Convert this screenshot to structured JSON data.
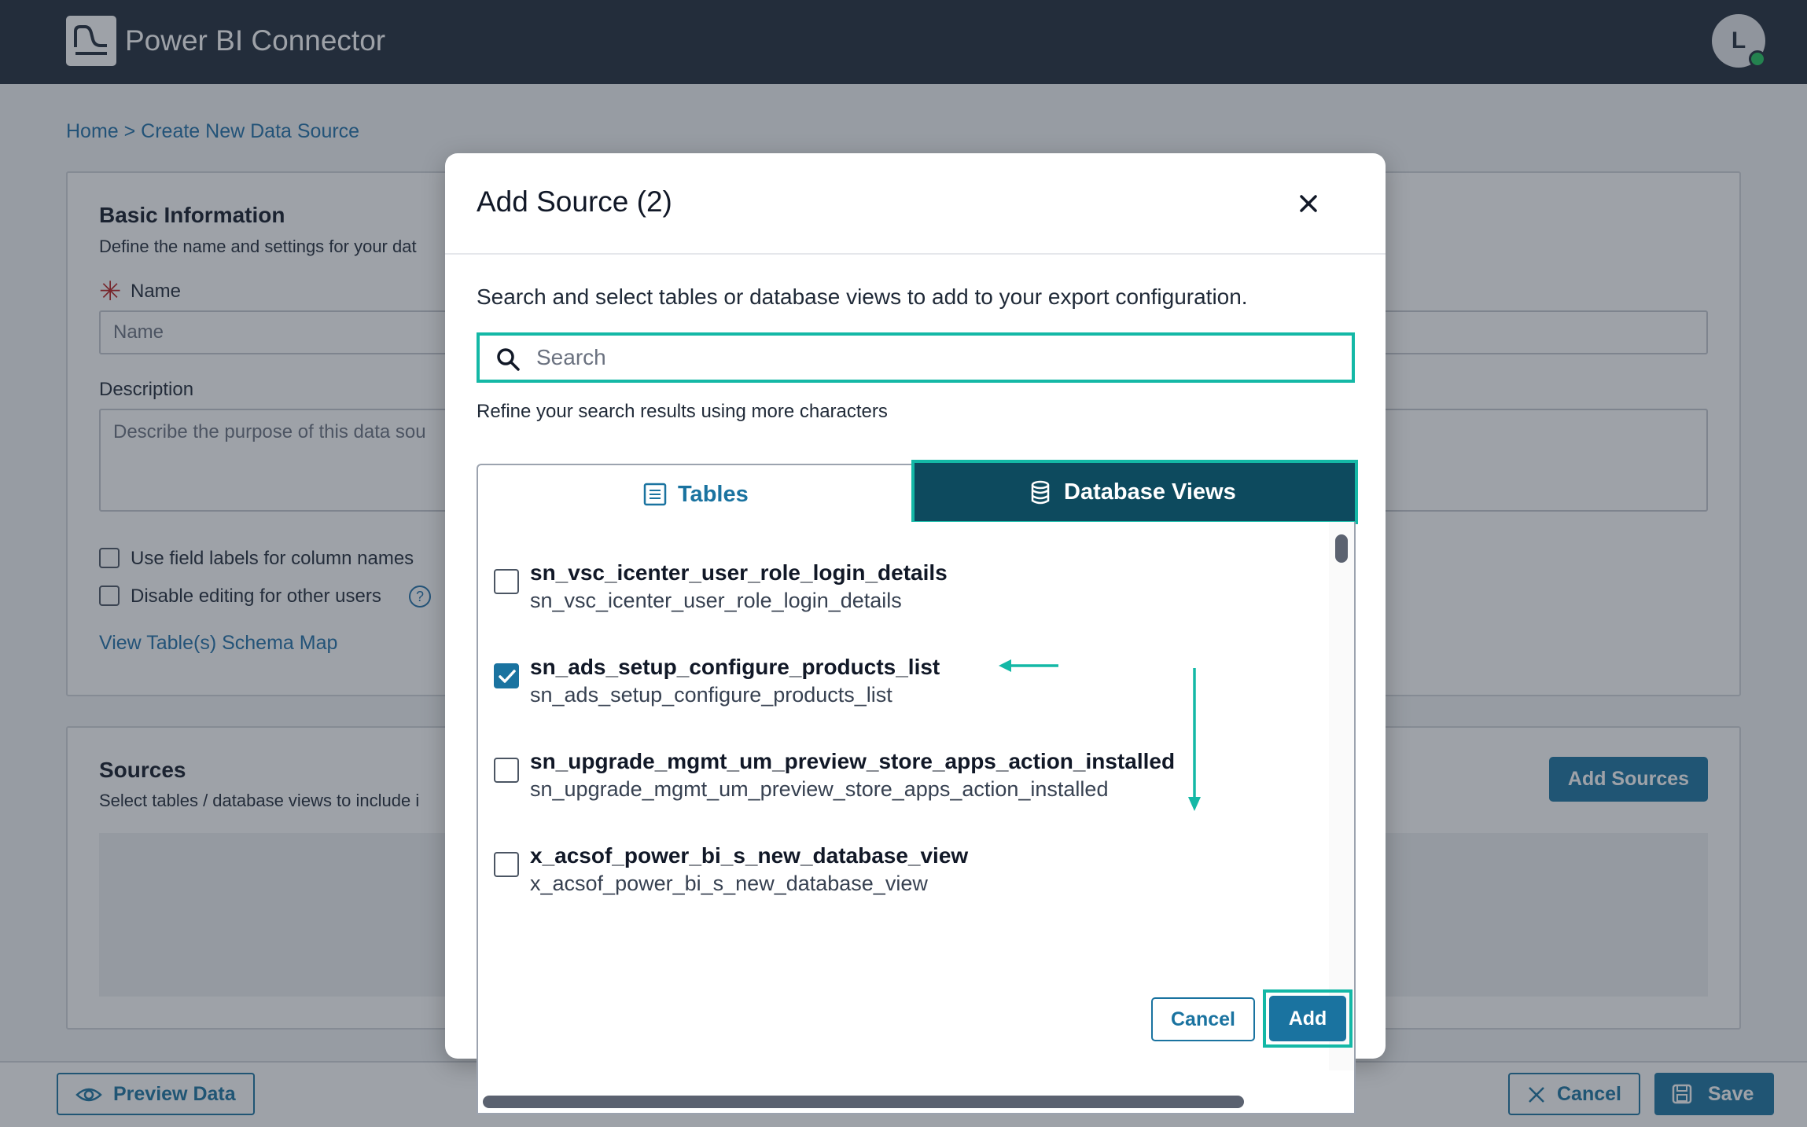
{
  "app": {
    "title": "Power BI Connector",
    "avatar_initial": "L"
  },
  "breadcrumb": "Home > Create New Data Source",
  "basic_info": {
    "title": "Basic Information",
    "subtitle": "Define the name and settings for your dat",
    "name_label": "Name",
    "name_placeholder": "Name",
    "description_label": "Description",
    "description_placeholder": "Describe the purpose of this data sou",
    "use_field_labels": "Use field labels for column names",
    "disable_editing": "Disable editing for other users",
    "schema_link": "View Table(s) Schema Map"
  },
  "sources": {
    "title": "Sources",
    "subtitle": "Select tables / database views to include i",
    "add_button": "Add Sources"
  },
  "footer": {
    "preview": "Preview Data",
    "cancel": "Cancel",
    "save": "Save"
  },
  "modal": {
    "title": "Add Source (2)",
    "description": "Search and select tables or database views to add to your export configuration.",
    "search_placeholder": "Search",
    "search_hint": "Refine your search results using more characters",
    "tabs": {
      "tables": "Tables",
      "views": "Database Views",
      "active": "views"
    },
    "items": [
      {
        "title": "sn_vsc_icenter_user_role_login_details",
        "subtitle": "sn_vsc_icenter_user_role_login_details",
        "checked": false
      },
      {
        "title": "sn_ads_setup_configure_products_list",
        "subtitle": "sn_ads_setup_configure_products_list",
        "checked": true
      },
      {
        "title": "sn_upgrade_mgmt_um_preview_store_apps_action_installed",
        "subtitle": "sn_upgrade_mgmt_um_preview_store_apps_action_installed",
        "checked": false
      },
      {
        "title": "x_acsof_power_bi_s_new_database_view",
        "subtitle": "x_acsof_power_bi_s_new_database_view",
        "checked": false
      }
    ],
    "cancel": "Cancel",
    "add": "Add"
  },
  "colors": {
    "accent": "#1a73a0",
    "highlight": "#14b8a6",
    "topbar": "#202a3a",
    "active_tab": "#0d4a5e"
  }
}
